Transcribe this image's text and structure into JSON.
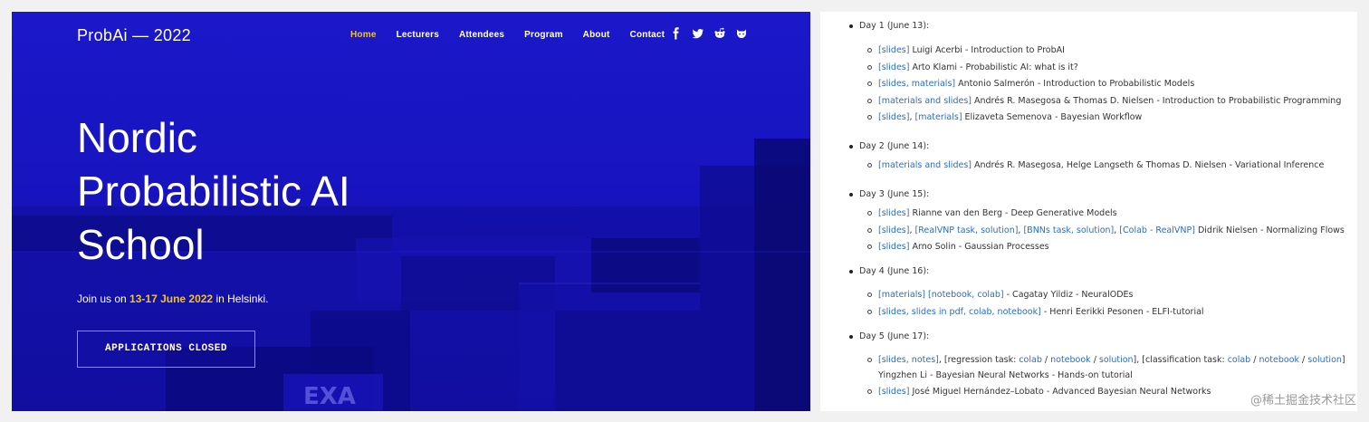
{
  "hero": {
    "brand": "ProbAi — 2022",
    "nav": [
      "Home",
      "Lecturers",
      "Attendees",
      "Program",
      "About",
      "Contact"
    ],
    "social_icons": [
      "facebook-icon",
      "twitter-icon",
      "reddit-icon",
      "github-icon"
    ],
    "title_lines": [
      "Nordic",
      "Probabilistic AI",
      "School"
    ],
    "tagline_prefix": "Join us on ",
    "tagline_dates": "13-17 June 2022",
    "tagline_suffix": " in Helsinki.",
    "cta": "APPLICATIONS CLOSED",
    "colors": {
      "background": "#1714bf",
      "accent": "#f2c12e"
    }
  },
  "program": {
    "days": [
      {
        "label": "Day 1 (June 13):",
        "items": [
          [
            [
              "[slides]",
              "link"
            ],
            [
              " Luigi Acerbi - Introduction to ProbAI",
              "text"
            ]
          ],
          [
            [
              "[slides]",
              "link"
            ],
            [
              " Arto Klami - Probabilistic AI: what is it?",
              "text"
            ]
          ],
          [
            [
              "[slides, materials]",
              "link"
            ],
            [
              " Antonio Salmerón - Introduction to Probabilistic Models",
              "text"
            ]
          ],
          [
            [
              "[materials and slides]",
              "link"
            ],
            [
              " Andrés R. Masegosa & Thomas D. Nielsen - Introduction to Probabilistic Programming",
              "text"
            ]
          ],
          [
            [
              "[slides]",
              "link"
            ],
            [
              ", ",
              "text"
            ],
            [
              "[materials]",
              "link"
            ],
            [
              " Elizaveta Semenova - Bayesian Workflow",
              "text"
            ]
          ]
        ]
      },
      {
        "label": "Day 2 (June 14):",
        "items": [
          [
            [
              "[materials and slides]",
              "link"
            ],
            [
              " Andrés R. Masegosa, Helge Langseth & Thomas D. Nielsen - Variational Inference",
              "text"
            ]
          ]
        ]
      },
      {
        "label": "Day 3 (June 15):",
        "items": [
          [
            [
              "[slides]",
              "link"
            ],
            [
              " Rianne van den Berg - Deep Generative Models",
              "text"
            ]
          ],
          [
            [
              "[slides]",
              "link"
            ],
            [
              ", ",
              "text"
            ],
            [
              "[RealVNP task, solution]",
              "link"
            ],
            [
              ", ",
              "text"
            ],
            [
              "[BNNs task, solution]",
              "link"
            ],
            [
              ", ",
              "text"
            ],
            [
              "[Colab - RealVNP]",
              "link"
            ],
            [
              " Didrik Nielsen - Normalizing Flows",
              "text"
            ]
          ],
          [
            [
              "[slides]",
              "link"
            ],
            [
              " Arno Solin - Gaussian Processes",
              "text"
            ]
          ]
        ]
      },
      {
        "label": "Day 4 (June 16):",
        "items": [
          [
            [
              "[materials]",
              "link"
            ],
            [
              " ",
              "text"
            ],
            [
              "[notebook, colab]",
              "link"
            ],
            [
              " - Cagatay Yildiz - NeuralODEs",
              "text"
            ]
          ],
          [
            [
              "[slides, slides in pdf, colab, notebook]",
              "link"
            ],
            [
              " - Henri Eerikki Pesonen - ELFI-tutorial",
              "text"
            ]
          ]
        ]
      },
      {
        "label": "Day 5 (June 17):",
        "items": [
          [
            [
              "[slides, notes]",
              "link"
            ],
            [
              ", [regression task: ",
              "text"
            ],
            [
              "colab",
              "link"
            ],
            [
              " / ",
              "text"
            ],
            [
              "notebook",
              "link"
            ],
            [
              " / ",
              "text"
            ],
            [
              "solution",
              "link"
            ],
            [
              "], [classification task: ",
              "text"
            ],
            [
              "colab",
              "link"
            ],
            [
              " / ",
              "text"
            ],
            [
              "notebook",
              "link"
            ],
            [
              " / ",
              "text"
            ],
            [
              "solution",
              "link"
            ],
            [
              "]",
              "text"
            ]
          ],
          [
            [
              "[slides]",
              "link"
            ],
            [
              " José Miguel Hernández–Lobato - Advanced Bayesian Neural Networks",
              "text"
            ]
          ]
        ]
      }
    ],
    "continuation": "Yingzhen Li - Bayesian Neural Networks - Hands-on tutorial",
    "link_color": "#2a6cc7"
  },
  "watermark": "@稀土掘金技术社区"
}
